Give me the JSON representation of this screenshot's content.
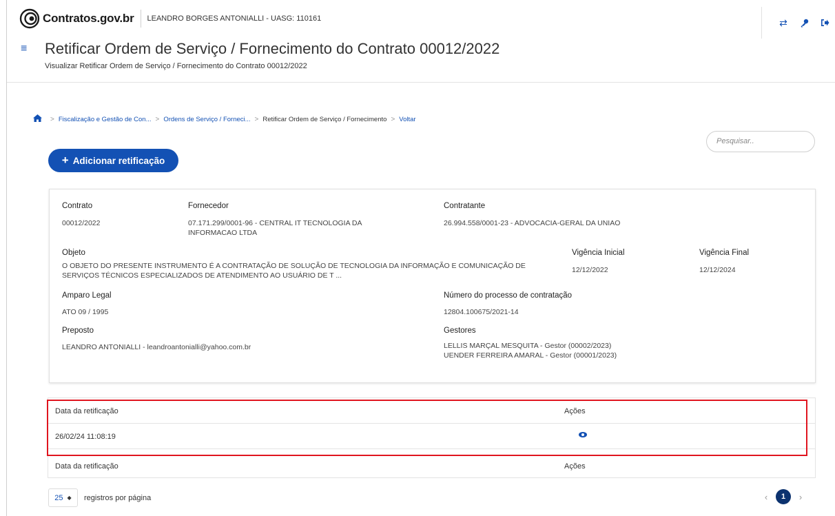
{
  "header": {
    "brand": "Contratos.gov.br",
    "user": "LEANDRO BORGES ANTONIALLI - UASG: 110161",
    "title": "Retificar Ordem de Serviço / Fornecimento do Contrato 00012/2022",
    "subtitle": "Visualizar Retificar Ordem de Serviço / Fornecimento do Contrato 00012/2022"
  },
  "breadcrumb": {
    "item1": "Fiscalização e Gestão de Con...",
    "item2": "Ordens de Serviço / Forneci...",
    "item3": "Retificar Ordem de Serviço / Fornecimento",
    "back": "Voltar"
  },
  "search": {
    "placeholder": "Pesquisar.."
  },
  "add_button": {
    "label": "Adicionar retificação"
  },
  "contract": {
    "contrato_label": "Contrato",
    "contrato_value": "00012/2022",
    "fornecedor_label": "Fornecedor",
    "fornecedor_value_1": "07.171.299/0001-96 - CENTRAL IT TECNOLOGIA DA",
    "fornecedor_value_2": "INFORMACAO LTDA",
    "contratante_label": "Contratante",
    "contratante_value": "26.994.558/0001-23 - ADVOCACIA-GERAL DA UNIAO",
    "objeto_label": "Objeto",
    "objeto_value_1": "O OBJETO DO PRESENTE INSTRUMENTO É A CONTRATAÇÃO DE SOLUÇÃO DE TECNOLOGIA DA INFORMAÇÃO E COMUNICAÇÃO DE",
    "objeto_value_2": "SERVIÇOS TÉCNICOS ESPECIALIZADOS DE ATENDIMENTO AO USUÁRIO DE T ...",
    "vig_ini_label": "Vigência Inicial",
    "vig_ini_value": "12/12/2022",
    "vig_fin_label": "Vigência Final",
    "vig_fin_value": "12/12/2024",
    "amparo_label": "Amparo Legal",
    "amparo_value": "ATO 09 / 1995",
    "processo_label": "Número do processo de contratação",
    "processo_value": "12804.100675/2021-14",
    "preposto_label": "Preposto",
    "preposto_value": "LEANDRO ANTONIALLI - leandroantonialli@yahoo.com.br",
    "gestores_label": "Gestores",
    "gestor_1": "LELLIS MARÇAL MESQUITA - Gestor (00002/2023)",
    "gestor_2": "UENDER FERREIRA AMARAL - Gestor (00001/2023)"
  },
  "table": {
    "col_date": "Data da retificação",
    "col_actions": "Ações",
    "rows": [
      {
        "date": "26/02/24 11:08:19"
      }
    ]
  },
  "pagination": {
    "per_page": "25",
    "per_page_label": "registros por página",
    "current_page": "1"
  },
  "colors": {
    "primary": "#1351b4",
    "highlight": "#e0141e",
    "page_active": "#0c326f"
  }
}
